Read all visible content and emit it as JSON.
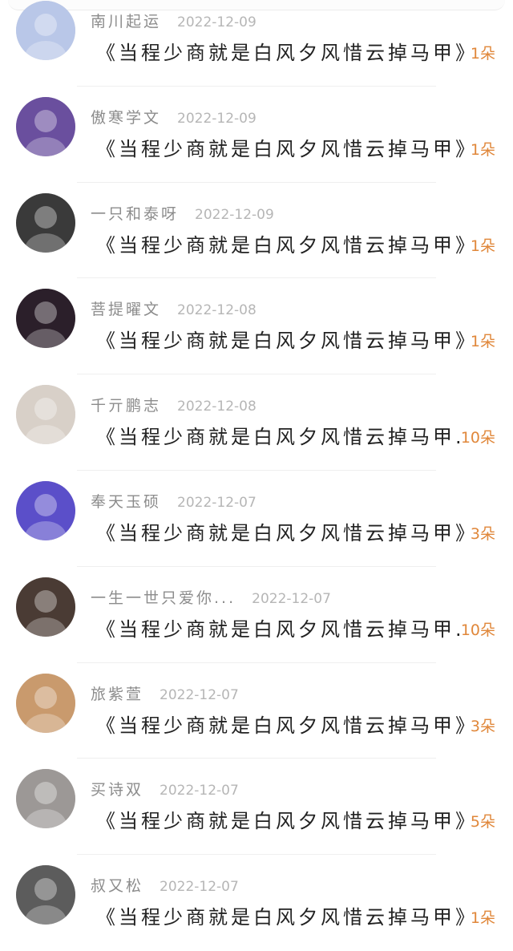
{
  "gift_records": [
    {
      "username": "南川起运",
      "date": "2022-12-09",
      "gift_title": "《当程少商就是白风夕风惜云掉马甲》",
      "count": "1朵",
      "avatar_color": "#b9c7e8"
    },
    {
      "username": "傲寒学文",
      "date": "2022-12-09",
      "gift_title": "《当程少商就是白风夕风惜云掉马甲》",
      "count": "1朵",
      "avatar_color": "#6a4f9e"
    },
    {
      "username": "一只和泰呀",
      "date": "2022-12-09",
      "gift_title": "《当程少商就是白风夕风惜云掉马甲》",
      "count": "1朵",
      "avatar_color": "#3a3a3a"
    },
    {
      "username": "菩提曜文",
      "date": "2022-12-08",
      "gift_title": "《当程少商就是白风夕风惜云掉马甲》",
      "count": "1朵",
      "avatar_color": "#2b1f2a"
    },
    {
      "username": "千亓鹏志",
      "date": "2022-12-08",
      "gift_title": "《当程少商就是白风夕风惜云掉马甲...",
      "count": "10朵",
      "avatar_color": "#d8d0c8"
    },
    {
      "username": "奉天玉硕",
      "date": "2022-12-07",
      "gift_title": "《当程少商就是白风夕风惜云掉马甲》",
      "count": "3朵",
      "avatar_color": "#5b4fc9"
    },
    {
      "username": "一生一世只爱你...",
      "date": "2022-12-07",
      "gift_title": "《当程少商就是白风夕风惜云掉马甲...",
      "count": "10朵",
      "avatar_color": "#4a3b34"
    },
    {
      "username": "旅紫萱",
      "date": "2022-12-07",
      "gift_title": "《当程少商就是白风夕风惜云掉马甲》",
      "count": "3朵",
      "avatar_color": "#c99a6d"
    },
    {
      "username": "买诗双",
      "date": "2022-12-07",
      "gift_title": "《当程少商就是白风夕风惜云掉马甲》",
      "count": "5朵",
      "avatar_color": "#9c9896"
    },
    {
      "username": "叔又松",
      "date": "2022-12-07",
      "gift_title": "《当程少商就是白风夕风惜云掉马甲》",
      "count": "1朵",
      "avatar_color": "#5c5c5c"
    }
  ]
}
